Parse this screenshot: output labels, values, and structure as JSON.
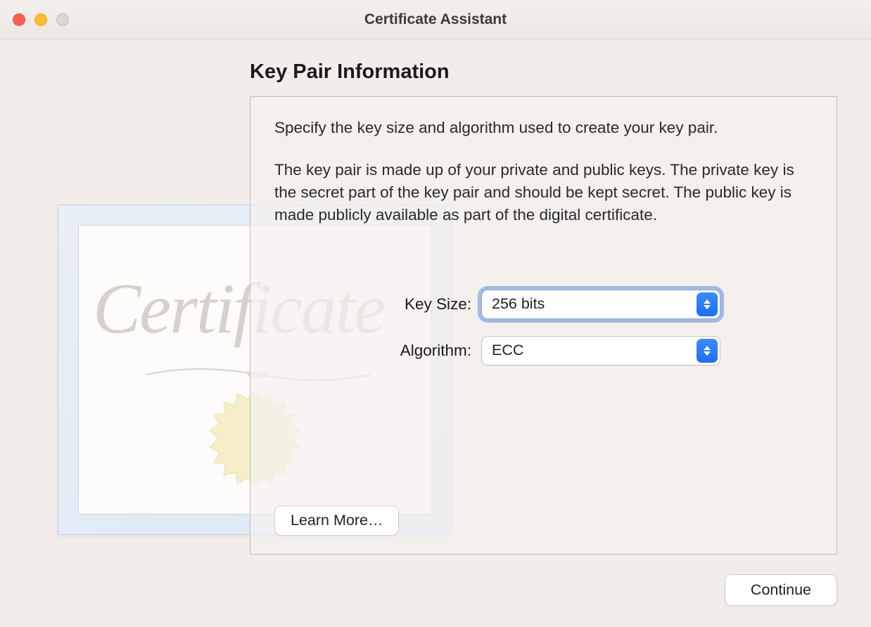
{
  "window": {
    "title": "Certificate Assistant"
  },
  "illustration": {
    "certificate_text": "Certificate"
  },
  "panel": {
    "title": "Key Pair Information",
    "desc1": "Specify the key size and algorithm used to create your key pair.",
    "desc2": "The key pair is made up of your private and public keys. The private key is the secret part of the key pair and should be kept secret. The public key is made publicly available as part of the digital certificate."
  },
  "form": {
    "key_size_label": "Key Size:",
    "key_size_value": "256 bits",
    "algorithm_label": "Algorithm:",
    "algorithm_value": "ECC"
  },
  "buttons": {
    "learn_more": "Learn More…",
    "continue": "Continue"
  }
}
